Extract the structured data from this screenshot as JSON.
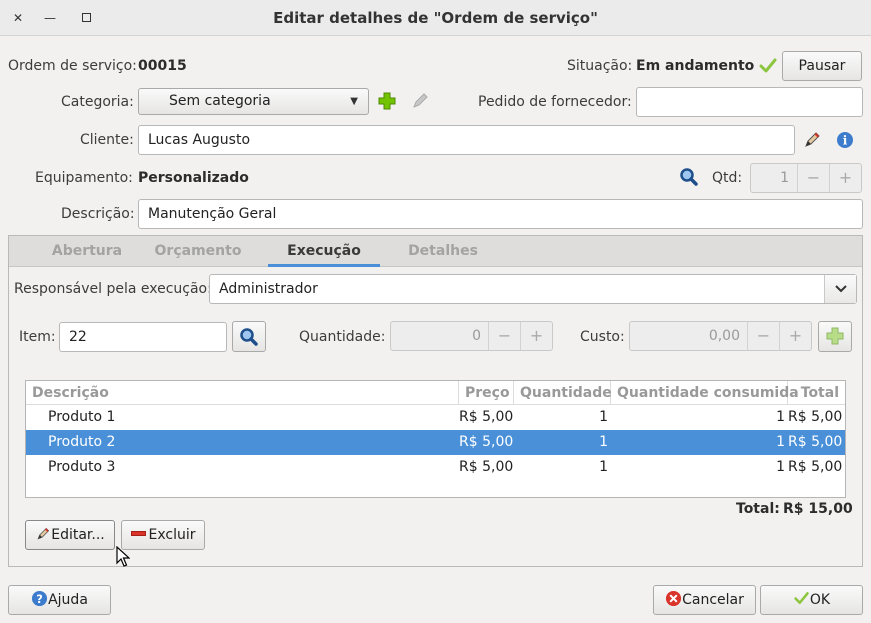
{
  "window": {
    "title": "Editar detalhes de \"Ordem de serviço\""
  },
  "header": {
    "order_label": "Ordem de serviço:",
    "order_value": "00015",
    "status_label": "Situação:",
    "status_value": "Em andamento",
    "pause_button": "Pausar",
    "category_label": "Categoria:",
    "category_value": "Sem categoria",
    "supplier_order_label": "Pedido de fornecedor:",
    "supplier_order_value": "",
    "client_label": "Cliente:",
    "client_value": "Lucas Augusto",
    "equipment_label": "Equipamento:",
    "equipment_value": "Personalizado",
    "qty_label": "Qtd:",
    "qty_value": "1",
    "description_label": "Descrição:",
    "description_value": "Manutenção Geral"
  },
  "tabs": [
    {
      "label": "Abertura",
      "active": false
    },
    {
      "label": "Orçamento",
      "active": false
    },
    {
      "label": "Execução",
      "active": true
    },
    {
      "label": "Detalhes",
      "active": false
    }
  ],
  "execution": {
    "responsible_label": "Responsável pela execução:",
    "responsible_value": "Administrador",
    "item_label": "Item:",
    "item_value": "22",
    "quantity_label": "Quantidade:",
    "quantity_value": "0",
    "cost_label": "Custo:",
    "cost_value": "0,00"
  },
  "table": {
    "columns": [
      "Descrição",
      "Preço",
      "Quantidade",
      "Quantidade consumida",
      "Total"
    ],
    "rows": [
      {
        "description": "Produto 1",
        "price": "R$ 5,00",
        "quantity": "1",
        "consumed": "1",
        "total": "R$ 5,00",
        "selected": false
      },
      {
        "description": "Produto 2",
        "price": "R$ 5,00",
        "quantity": "1",
        "consumed": "1",
        "total": "R$ 5,00",
        "selected": true
      },
      {
        "description": "Produto 3",
        "price": "R$ 5,00",
        "quantity": "1",
        "consumed": "1",
        "total": "R$ 5,00",
        "selected": false
      }
    ],
    "total_label": "Total:",
    "total_value": "R$ 15,00"
  },
  "actions": {
    "edit": "Editar...",
    "delete": "Excluir"
  },
  "footer": {
    "help": "Ajuda",
    "cancel": "Cancelar",
    "ok": "OK"
  },
  "colors": {
    "accent": "#4a90d9",
    "add": "#73c400",
    "check": "#8cc63f",
    "danger": "#d9332a"
  }
}
